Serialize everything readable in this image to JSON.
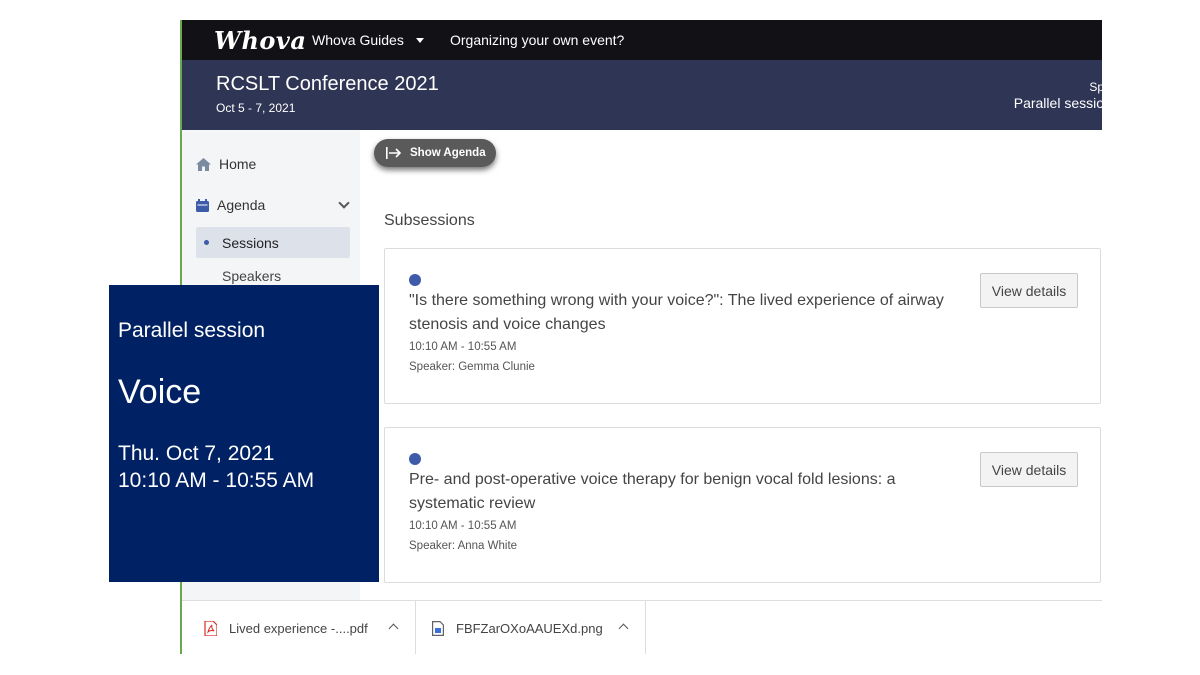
{
  "topbar": {
    "logo": "Whova",
    "nav_guides": "Whova Guides",
    "nav_organizing": "Organizing your own event?"
  },
  "event": {
    "title": "RCSLT Conference 2021",
    "dates": "Oct 5 - 7, 2021",
    "right_line1": "Sp",
    "right_line2": "Parallel sessio"
  },
  "sidebar": {
    "home": "Home",
    "agenda": "Agenda",
    "sessions": "Sessions",
    "speakers": "Speakers"
  },
  "main": {
    "show_agenda": "Show Agenda",
    "subsessions_heading": "Subsessions",
    "cards": [
      {
        "title": "\"Is there something wrong with your voice?\": The lived experience of airway stenosis and voice changes",
        "time": "10:10 AM - 10:55 AM",
        "speaker": "Speaker: Gemma Clunie",
        "button": "View details"
      },
      {
        "title": "Pre- and post-operative voice therapy for benign vocal fold lesions: a systematic review",
        "time": "10:10 AM - 10:55 AM",
        "speaker": "Speaker: Anna White",
        "button": "View details"
      }
    ]
  },
  "downloads": [
    {
      "name": "Lived experience -....pdf",
      "icon": "pdf-icon"
    },
    {
      "name": "FBFZarOXoAAUEXd.png",
      "icon": "image-file-icon"
    }
  ],
  "overlay": {
    "label": "Parallel session",
    "title": "Voice",
    "date": "Thu. Oct 7, 2021",
    "time": "10:10 AM - 10:55 AM"
  },
  "colors": {
    "topbar": "#111116",
    "eventbar": "#2f3554",
    "overlay": "#002163",
    "accent_dot": "#3d5ba8",
    "frame_border": "#6aa84f"
  }
}
